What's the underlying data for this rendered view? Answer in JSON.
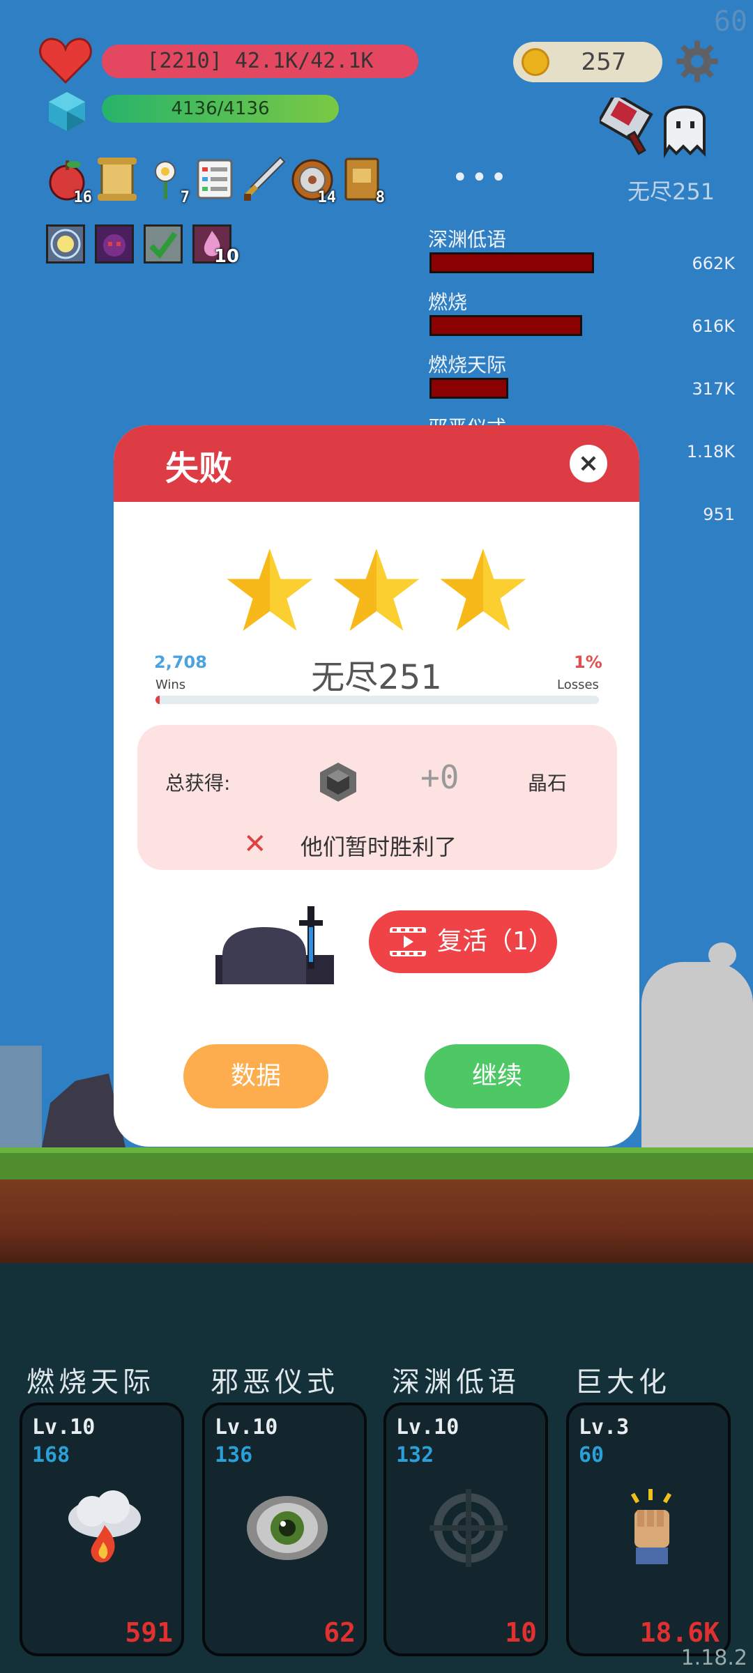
{
  "fps": "60",
  "hud": {
    "hp_text": "[2210] 42.1K/42.1K",
    "hp_fraction": 1.0,
    "mana_text": "4136/4136",
    "mana_fraction": 1.0,
    "coins": "257",
    "wave_label": "无尽251",
    "more_dots": "•••"
  },
  "items": [
    {
      "icon": "apple-icon",
      "count": "16"
    },
    {
      "icon": "scroll-icon",
      "count": ""
    },
    {
      "icon": "flower-icon",
      "count": "7"
    },
    {
      "icon": "list-icon",
      "count": ""
    },
    {
      "icon": "sword-icon",
      "count": ""
    },
    {
      "icon": "shield-icon",
      "count": "14"
    },
    {
      "icon": "book-icon",
      "count": "8"
    }
  ],
  "buffs": [
    {
      "icon": "light-buff-icon",
      "count": ""
    },
    {
      "icon": "demon-buff-icon",
      "count": ""
    },
    {
      "icon": "plant-buff-icon",
      "count": ""
    },
    {
      "icon": "flame-buff-icon",
      "count": "10"
    }
  ],
  "damage_list": [
    {
      "name": "深渊低语",
      "value": "662K",
      "fraction": 1.0
    },
    {
      "name": "燃烧",
      "value": "616K",
      "fraction": 0.93
    },
    {
      "name": "燃烧天际",
      "value": "317K",
      "fraction": 0.48
    },
    {
      "name": "邪恶仪式",
      "value": "1.18K",
      "fraction": 0.0
    },
    {
      "name": "",
      "value": "951",
      "fraction": 0.0
    }
  ],
  "dialog": {
    "title": "失败",
    "close_icon": "×",
    "stars": 3,
    "wins_count": "2,708",
    "wins_label": "Wins",
    "losses_pct": "1%",
    "losses_label": "Losses",
    "wave": "无尽251",
    "loss_fraction": 0.01,
    "reward_label": "总获得:",
    "reward_amount": "+0",
    "reward_unit": "晶石",
    "fail_mark": "✕",
    "fail_text": "他们暂时胜利了",
    "revive_label": "复活（1）",
    "data_button": "数据",
    "continue_button": "继续"
  },
  "skills": [
    {
      "name": "燃烧天际",
      "level": "Lv.10",
      "cost": "168",
      "damage": "591",
      "icon": "fire-cloud-icon"
    },
    {
      "name": "邪恶仪式",
      "level": "Lv.10",
      "cost": "136",
      "damage": "62",
      "icon": "eye-icon"
    },
    {
      "name": "深渊低语",
      "level": "Lv.10",
      "cost": "132",
      "damage": "10",
      "icon": "crosshair-icon"
    },
    {
      "name": "巨大化",
      "level": "Lv.3",
      "cost": "60",
      "damage": "18.6K",
      "icon": "fist-icon"
    }
  ],
  "version": "1.18.2",
  "colors": {
    "sky": "#2f7fc4",
    "dialog_header": "#de3c45",
    "data_button": "#fdad4d",
    "continue_button": "#4dc865",
    "revive_button": "#ef4348",
    "star": "#fbcf2f"
  }
}
